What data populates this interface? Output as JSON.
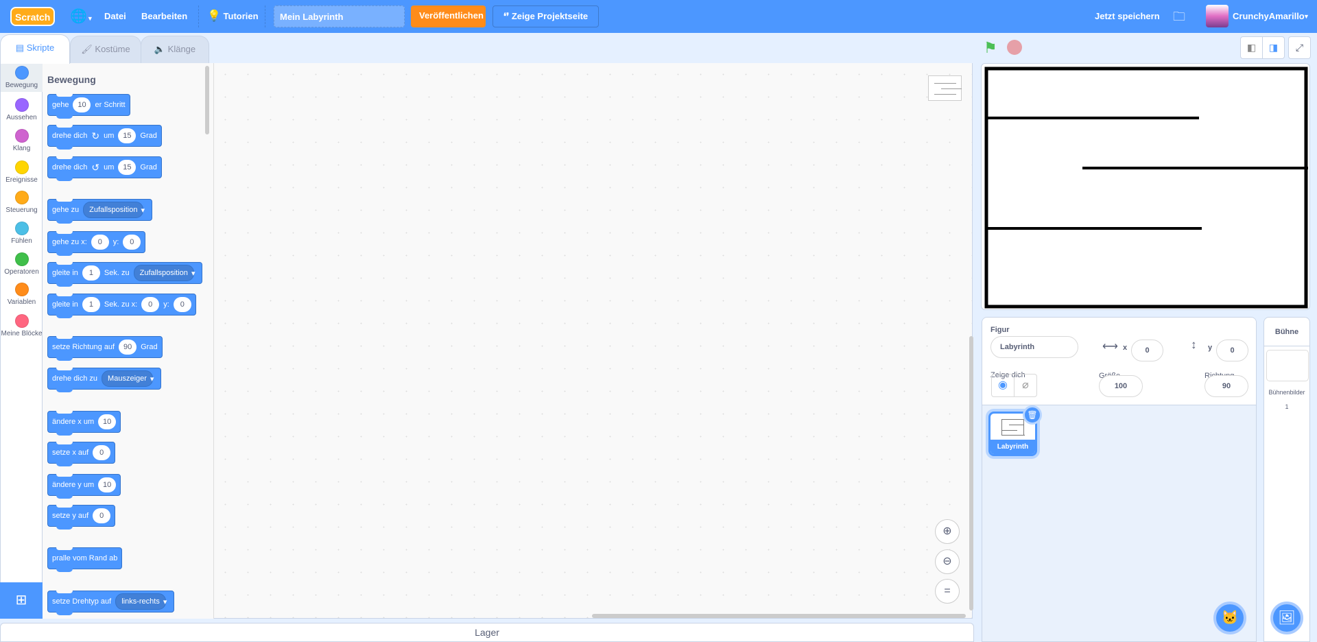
{
  "menu": {
    "logo": "Scratch",
    "file": "Datei",
    "edit": "Bearbeiten",
    "tutorials": "Tutorien",
    "project_title": "Mein Labyrinth",
    "share": "Veröffentlichen",
    "see_project_page": "Zeige Projektseite",
    "save_now": "Jetzt speichern",
    "username": "CrunchyAmarillo"
  },
  "tabs": [
    {
      "label": "Skripte",
      "active": true
    },
    {
      "label": "Kostüme"
    },
    {
      "label": "Klänge"
    }
  ],
  "categories": [
    {
      "label": "Bewegung",
      "color": "#4c97ff"
    },
    {
      "label": "Aussehen",
      "color": "#9966ff"
    },
    {
      "label": "Klang",
      "color": "#cf63cf"
    },
    {
      "label": "Ereignisse",
      "color": "#ffd500"
    },
    {
      "label": "Steuerung",
      "color": "#ffab19"
    },
    {
      "label": "Fühlen",
      "color": "#4cbfe6"
    },
    {
      "label": "Operatoren",
      "color": "#40bf4a"
    },
    {
      "label": "Variablen",
      "color": "#ff8c1a"
    },
    {
      "label": "Meine Blöcke",
      "color": "#ff6680"
    }
  ],
  "flyout": {
    "heading": "Bewegung",
    "blocks": [
      [
        {
          "t": "text",
          "v": "gehe"
        },
        {
          "t": "num",
          "v": "10"
        },
        {
          "t": "text",
          "v": "er Schritt"
        }
      ],
      [
        {
          "t": "text",
          "v": "drehe dich"
        },
        {
          "t": "icon",
          "v": "↻",
          "n": "rotate-right-icon"
        },
        {
          "t": "text",
          "v": "um"
        },
        {
          "t": "num",
          "v": "15"
        },
        {
          "t": "text",
          "v": "Grad"
        }
      ],
      [
        {
          "t": "text",
          "v": "drehe dich"
        },
        {
          "t": "icon",
          "v": "↺",
          "n": "rotate-left-icon"
        },
        {
          "t": "text",
          "v": "um"
        },
        {
          "t": "num",
          "v": "15"
        },
        {
          "t": "text",
          "v": "Grad"
        }
      ],
      [
        {
          "t": "text",
          "v": "gehe zu"
        },
        {
          "t": "dd",
          "v": "Zufallsposition"
        }
      ],
      [
        {
          "t": "text",
          "v": "gehe zu x:"
        },
        {
          "t": "num",
          "v": "0"
        },
        {
          "t": "text",
          "v": "y:"
        },
        {
          "t": "num",
          "v": "0"
        }
      ],
      [
        {
          "t": "text",
          "v": "gleite in"
        },
        {
          "t": "num",
          "v": "1"
        },
        {
          "t": "text",
          "v": "Sek. zu"
        },
        {
          "t": "dd",
          "v": "Zufallsposition"
        }
      ],
      [
        {
          "t": "text",
          "v": "gleite in"
        },
        {
          "t": "num",
          "v": "1"
        },
        {
          "t": "text",
          "v": "Sek. zu x:"
        },
        {
          "t": "num",
          "v": "0"
        },
        {
          "t": "text",
          "v": "y:"
        },
        {
          "t": "num",
          "v": "0"
        }
      ],
      [
        {
          "t": "text",
          "v": "setze Richtung auf"
        },
        {
          "t": "num",
          "v": "90"
        },
        {
          "t": "text",
          "v": "Grad"
        }
      ],
      [
        {
          "t": "text",
          "v": "drehe dich zu"
        },
        {
          "t": "dd",
          "v": "Mauszeiger"
        }
      ],
      [
        {
          "t": "text",
          "v": "ändere x um"
        },
        {
          "t": "num",
          "v": "10"
        }
      ],
      [
        {
          "t": "text",
          "v": "setze x auf"
        },
        {
          "t": "num",
          "v": "0"
        }
      ],
      [
        {
          "t": "text",
          "v": "ändere y um"
        },
        {
          "t": "num",
          "v": "10"
        }
      ],
      [
        {
          "t": "text",
          "v": "setze y auf"
        },
        {
          "t": "num",
          "v": "0"
        }
      ],
      [
        {
          "t": "text",
          "v": "pralle vom Rand ab"
        }
      ],
      [
        {
          "t": "text",
          "v": "setze Drehtyp auf"
        },
        {
          "t": "dd",
          "v": "links-rechts"
        }
      ]
    ]
  },
  "backpack": "Lager",
  "sprite_info": {
    "sprite_label": "Figur",
    "sprite_name": "Labyrinth",
    "x_label": "x",
    "x": "0",
    "y_label": "y",
    "y": "0",
    "show_label": "Zeige dich",
    "size_label": "Größe",
    "size": "100",
    "direction_label": "Richtung",
    "direction": "90"
  },
  "sprites": [
    {
      "name": "Labyrinth",
      "selected": true
    }
  ],
  "stage_pane": {
    "title": "Bühne",
    "backdrops_label": "Bühnenbilder",
    "backdrops_count": "1"
  }
}
